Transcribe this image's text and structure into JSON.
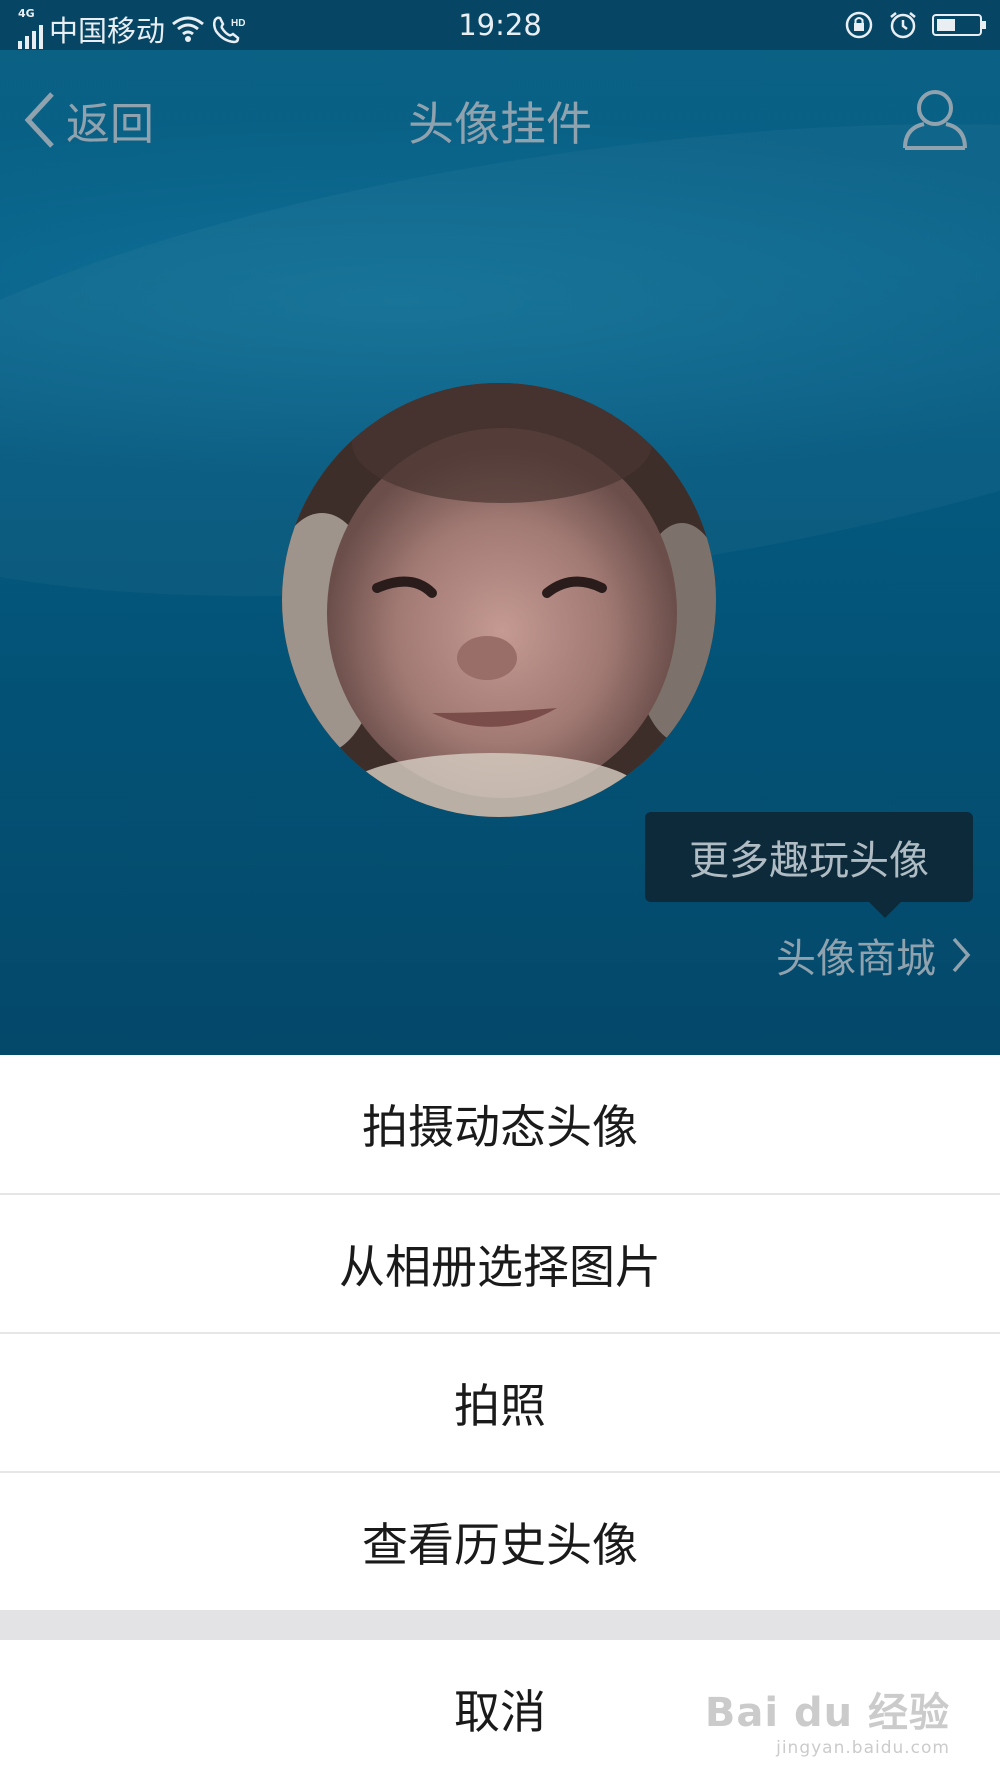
{
  "status_bar": {
    "network": "4G",
    "carrier": "中国移动",
    "time": "19:28",
    "battery_level": 0.45
  },
  "nav": {
    "back_label": "返回",
    "title": "头像挂件"
  },
  "tooltip": {
    "text": "更多趣玩头像"
  },
  "mall_link": {
    "label": "头像商城"
  },
  "action_sheet": {
    "items": [
      {
        "label": "拍摄动态头像"
      },
      {
        "label": "从相册选择图片"
      },
      {
        "label": "拍照"
      },
      {
        "label": "查看历史头像"
      }
    ],
    "cancel_label": "取消"
  },
  "watermark": {
    "main": "Bai du 经验",
    "sub": "jingyan.baidu.com"
  },
  "colors": {
    "header_bg": "#066087",
    "status_bar_bg": "#074564",
    "nav_text": "#8fa2ae",
    "tooltip_bg": "#0d2a3a",
    "sheet_bg": "#ffffff",
    "sheet_gap": "#e3e3e5"
  }
}
